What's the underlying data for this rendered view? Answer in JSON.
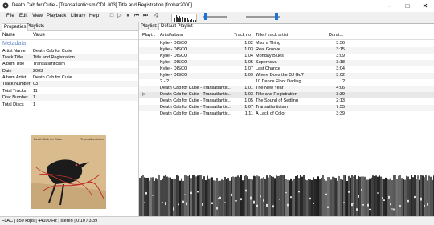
{
  "window": {
    "title": "Death Cab for Cutie - [Transatlanticism CD1 #03] Title and Registration  [foobar2000]"
  },
  "menu": [
    "File",
    "Edit",
    "View",
    "Playback",
    "Library",
    "Help"
  ],
  "toolbar": {
    "buttons": [
      "stop-icon",
      "play-icon",
      "pause-icon",
      "previous-icon",
      "next-icon",
      "shuffle-icon"
    ]
  },
  "left_tabs": [
    "Properties",
    "Playlists"
  ],
  "properties": {
    "col_name": "Name",
    "col_value": "Value",
    "section": "Metadata",
    "rows": [
      {
        "name": "Artist Name",
        "value": "Death Cab for Cutie"
      },
      {
        "name": "Track Title",
        "value": "Title and Registration"
      },
      {
        "name": "Album Title",
        "value": "Transatlanticism"
      },
      {
        "name": "Date",
        "value": "2003"
      },
      {
        "name": "Album Artist",
        "value": "Death Cab for Cutie"
      },
      {
        "name": "Track Number",
        "value": "03"
      },
      {
        "name": "Total Tracks",
        "value": "11"
      },
      {
        "name": "Disc Number",
        "value": "1"
      },
      {
        "name": "Total Discs",
        "value": "1"
      }
    ]
  },
  "album_art": {
    "artist": "Death Cab for Cutie",
    "title": "Transatlanticism"
  },
  "playlist": {
    "label": "Playlist:",
    "selected": "Default Playlist",
    "columns": [
      "Playi...",
      "Artist/album",
      "Track no",
      "Title / track artist",
      "Durat..."
    ],
    "rows": [
      {
        "play": "",
        "artist": "Kylie - DISCO",
        "track": "1.02",
        "title": "Miss a Thing",
        "duration": "3:56"
      },
      {
        "play": "",
        "artist": "Kylie - DISCO",
        "track": "1.03",
        "title": "Real Groove",
        "duration": "3:15"
      },
      {
        "play": "",
        "artist": "Kylie - DISCO",
        "track": "1.04",
        "title": "Monday Blues",
        "duration": "3:09"
      },
      {
        "play": "",
        "artist": "Kylie - DISCO",
        "track": "1.05",
        "title": "Supernova",
        "duration": "3:18"
      },
      {
        "play": "",
        "artist": "Kylie - DISCO",
        "track": "1.07",
        "title": "Last Chance",
        "duration": "3:04"
      },
      {
        "play": "",
        "artist": "Kylie - DISCO",
        "track": "1.09",
        "title": "Where Does the DJ Go?",
        "duration": "3:02"
      },
      {
        "play": "",
        "artist": "? - ?",
        "track": "",
        "title": "10 Dance Floor Darling",
        "duration": "?"
      },
      {
        "play": "",
        "artist": "Death Cab for Cutie - Transatlantic...",
        "track": "1.01",
        "title": "The New Year",
        "duration": "4:06"
      },
      {
        "play": "▷",
        "artist": "Death Cab for Cutie - Transatlantic...",
        "track": "1.03",
        "title": "Title and Registration",
        "duration": "3:39"
      },
      {
        "play": "",
        "artist": "Death Cab for Cutie - Transatlantic...",
        "track": "1.05",
        "title": "The Sound of Settling",
        "duration": "2:13"
      },
      {
        "play": "",
        "artist": "Death Cab for Cutie - Transatlantic...",
        "track": "1.07",
        "title": "Transatlanticism",
        "duration": "7:55"
      },
      {
        "play": "",
        "artist": "Death Cab for Cutie - Transatlantic...",
        "track": "1.11",
        "title": "A Lack of Color",
        "duration": "3:39"
      }
    ]
  },
  "status": "FLAC | 850 kbps | 44100 Hz | stereo | 0:10 / 3:39",
  "playback": {
    "seek_fraction": 0.05,
    "volume_fraction": 0.95
  },
  "colors": {
    "accent": "#1a73d9",
    "metadata_heading": "#6a8cc6"
  }
}
